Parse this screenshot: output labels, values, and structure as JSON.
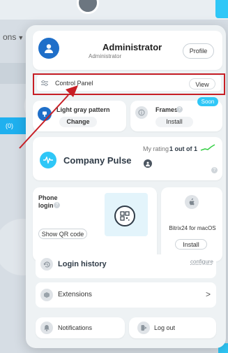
{
  "background": {
    "partial_menu_label": "ons",
    "badge_text": "(0)"
  },
  "header": {
    "name": "Administrator",
    "role": "Administrator",
    "profile_button": "Profile"
  },
  "control_panel": {
    "label": "Control Panel",
    "view_button": "View"
  },
  "theme": {
    "label": "Light gray pattern",
    "change_button": "Change"
  },
  "frames": {
    "label": "Frames",
    "badge": "Soon",
    "install_button": "Install"
  },
  "company_pulse": {
    "label": "Company Pulse",
    "rating_prefix": "My rating",
    "rating_value": "1 out of 1"
  },
  "phone_login": {
    "label_line1": "Phone",
    "label_line2": "login",
    "qr_button": "Show QR code"
  },
  "bitrix_mac": {
    "label": "Bitrix24 for macOS",
    "install_button": "Install"
  },
  "login_history": {
    "label": "Login history",
    "configure_link": "configure"
  },
  "extensions": {
    "label": "Extensions",
    "chevron": ">"
  },
  "notifications": {
    "label": "Notifications"
  },
  "logout": {
    "label": "Log out"
  },
  "colors": {
    "accent_blue": "#2fc7f7",
    "avatar_blue": "#1f6fc9",
    "highlight_red": "#c71e25",
    "pulse_green": "#3bd14a"
  }
}
